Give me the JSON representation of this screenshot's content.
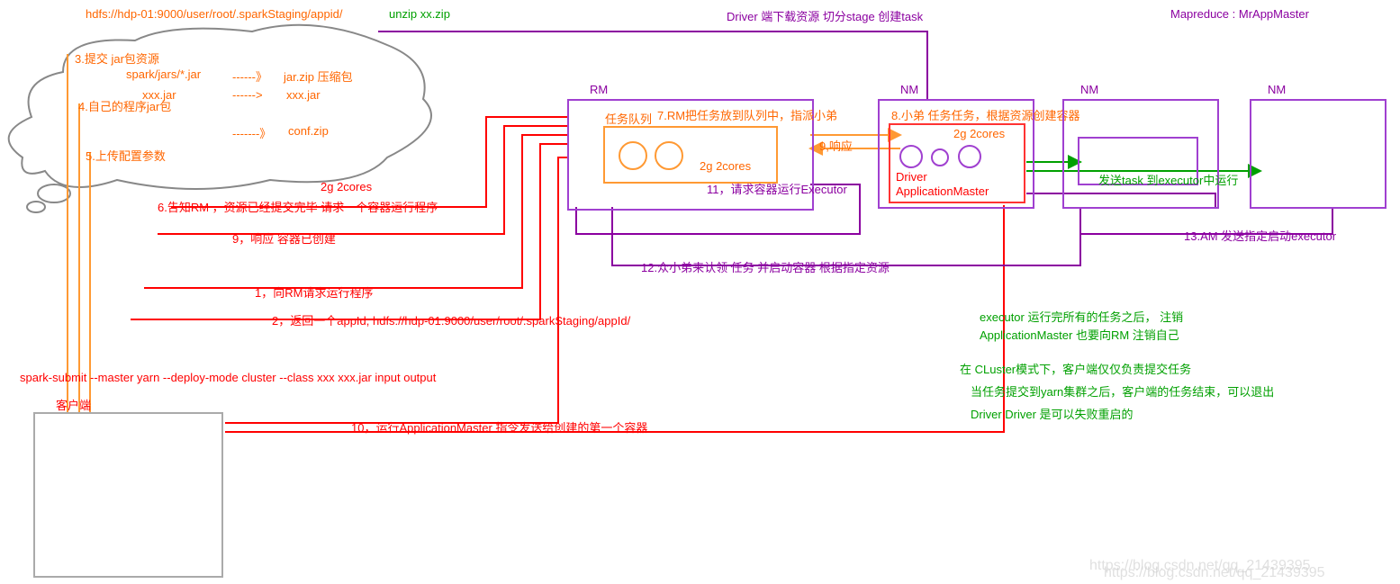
{
  "header": {
    "hdfs_path": "hdfs://hdp-01:9000/user/root/.sparkStaging/appid/",
    "unzip": "unzip xx.zip",
    "driver_stage": "Driver 端下载资源   切分stage   创建task",
    "mapreduce": "Mapreduce : MrAppMaster"
  },
  "cloud": {
    "step3": "3.提交 jar包资源",
    "step4": "4.自己的程序jar包",
    "step5": "5.上传配置参数",
    "jar1_src": "spark/jars/*.jar",
    "jar1_arrow": "------》",
    "jar1_dst": "jar.zip 压缩包",
    "jar2_src": "xxx.jar",
    "jar2_arrow": "------>",
    "jar2_dst": "xxx.jar",
    "conf_arrow": "-------》",
    "conf_dst": "conf.zip"
  },
  "flow": {
    "res_spec": "2g  2cores",
    "step6": "6.告知RM ，资源已经提交完毕  请求一个容器运行程序",
    "step9a": "9，响应 容器已创建",
    "step1": "1，向RM请求运行程序",
    "step2": "2，返回一个appId,  hdfs://hdp-01:9000/user/root/.sparkStaging/appId/",
    "step10": "10，运行ApplicationMaster   指令发送给创建的第一个容器",
    "step12": "12.众小弟来认领 任务 并启动容器 根据指定资源"
  },
  "rm": {
    "label": "RM",
    "queue": "任务队列",
    "step7": "7.RM把任务放到队列中，指派小弟",
    "spec": "2g 2cores",
    "step9b": "9,响应",
    "step11": "11，请求容器运行Executor"
  },
  "nm1": {
    "label": "NM",
    "step8": "8.小弟   任务任务，根据资源创建容器",
    "spec": "2g 2cores",
    "driver": "Driver",
    "am": "ApplicationMaster",
    "send_task": "发送task 到executor中运行"
  },
  "nm2": {
    "label": "NM"
  },
  "nm3": {
    "label": "NM"
  },
  "step13": "13.AM  发送指定启动executor",
  "client": {
    "cmd": "spark-submit --master yarn --deploy-mode cluster  --class xxx  xxx.jar input output",
    "label": "客户端"
  },
  "notes": {
    "n1": "executor 运行完所有的任务之后，  注销",
    "n2": "ApplicationMaster 也要向RM 注销自己",
    "n3": "在 CLuster模式下，客户端仅仅负责提交任务",
    "n4": "当任务提交到yarn集群之后，客户端的任务结束，可以退出",
    "n5": "Driver   Driver 是可以失败重启的"
  },
  "watermark1": "https://blog.csdn.net/qq_21439395",
  "watermark2": "https://blog.csdn.net/qq_21439395"
}
